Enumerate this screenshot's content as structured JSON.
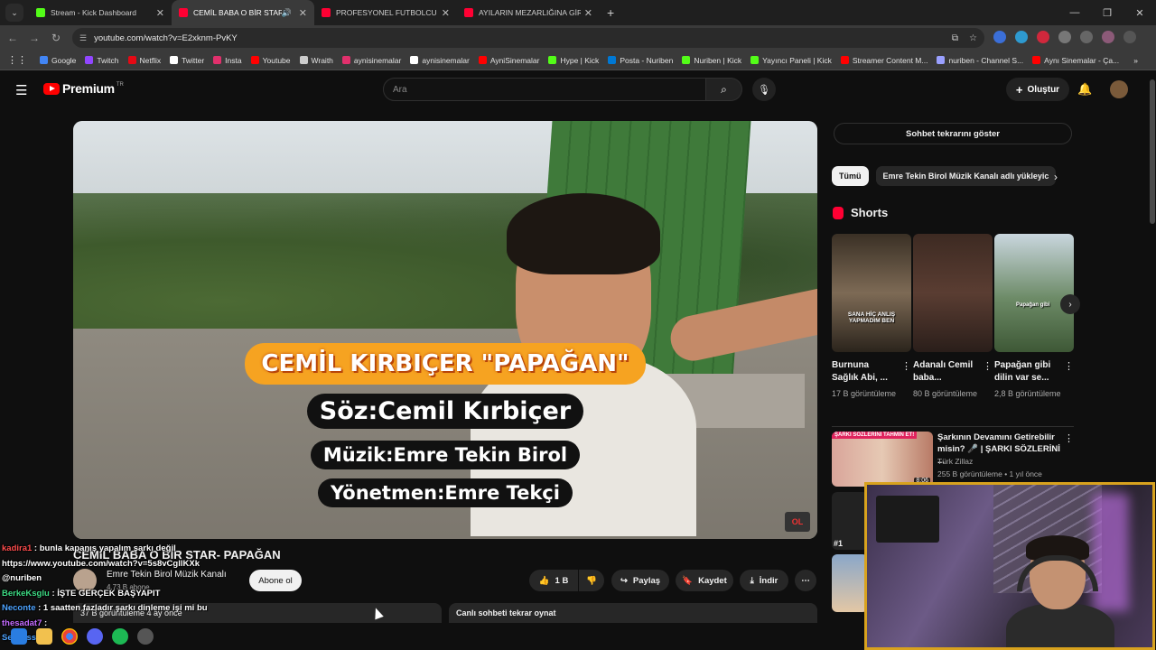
{
  "browser": {
    "tabs": [
      {
        "title": "Stream - Kick Dashboard",
        "favicon_color": "#53fc18",
        "active": false
      },
      {
        "title": "CEMİL BABA O BİR STAR- PA",
        "favicon_color": "#ff0033",
        "active": true
      },
      {
        "title": "PROFESYONEL FUTBOLCU SEN",
        "favicon_color": "#ff0033",
        "active": false
      },
      {
        "title": "AYILARIN MEZARLIĞINA GİRDİ",
        "favicon_color": "#ff0033",
        "active": false
      }
    ],
    "url": "youtube.com/watch?v=E2xknm-PvKY",
    "bookmarks": [
      {
        "label": "Google",
        "color": "#4285f4"
      },
      {
        "label": "Twitch",
        "color": "#9146ff"
      },
      {
        "label": "Netflix",
        "color": "#e50914"
      },
      {
        "label": "Twitter",
        "color": "#ffffff"
      },
      {
        "label": "Insta",
        "color": "#e1306c"
      },
      {
        "label": "Youtube",
        "color": "#ff0000"
      },
      {
        "label": "Wraith",
        "color": "#cccccc"
      },
      {
        "label": "aynisinemalar",
        "color": "#e1306c"
      },
      {
        "label": "aynisinemalar",
        "color": "#ffffff"
      },
      {
        "label": "AyniSinemalar",
        "color": "#ff0000"
      },
      {
        "label": "Hype | Kick",
        "color": "#53fc18"
      },
      {
        "label": "Posta - Nuriben",
        "color": "#0078d4"
      },
      {
        "label": "Nuriben | Kick",
        "color": "#53fc18"
      },
      {
        "label": "Yayıncı Paneli | Kick",
        "color": "#53fc18"
      },
      {
        "label": "Streamer Content M...",
        "color": "#ff0000"
      },
      {
        "label": "nuriben - Channel S...",
        "color": "#9aa0ff"
      },
      {
        "label": "Aynı Sinemalar - Ça...",
        "color": "#ff0000"
      }
    ]
  },
  "youtube": {
    "logo_text": "Premium",
    "logo_tr": "TR",
    "search_placeholder": "Ara",
    "create_label": "Oluştur"
  },
  "video": {
    "captions": {
      "title": "CEMİL KIRBIÇER \"PAPAĞAN\"",
      "lyrics": "Söz:Cemil Kırbiçer",
      "music": "Müzik:Emre Tekin Birol",
      "director": "Yönetmen:Emre Tekçi"
    },
    "watermark": "OL",
    "title": "CEMİL BABA O BİR STAR- PAPAĞAN",
    "channel": "Emre Tekin Birol Müzik Kanalı",
    "subs": "4,73 B abone",
    "subscribe_label": "Abone ol",
    "like_count": "1 B",
    "share_label": "Paylaş",
    "save_label": "Kaydet",
    "download_label": "İndir",
    "desc_meta": "37 B görüntüleme  4 ay önce",
    "chat_replay_label": "Canlı sohbeti tekrar oynat"
  },
  "chat": [
    {
      "user": "kadira1",
      "msg": ": bunla kapanış yapalım şarkı değil",
      "color": "#ff4d4d"
    },
    {
      "user": "",
      "msg": "https://www.youtube.com/watch?v=5s8vCgllKXk",
      "color": "#ffffff"
    },
    {
      "user": "@nuriben",
      "msg": "",
      "color": "#ffffff"
    },
    {
      "user": "BerkeKsglu",
      "msg": ": İŞTE GERÇEK BAŞYAPIT",
      "color": "#3ddc84"
    },
    {
      "user": "Neconte",
      "msg": ": 1 saatten fazladır şarkı dinleme işi mi bu",
      "color": "#4da3ff"
    },
    {
      "user": "thesadat7",
      "msg": ":",
      "color": "#c46bff"
    },
    {
      "user": "Seveliss",
      "msg": "",
      "color": "#4da3ff"
    }
  ],
  "sidebar": {
    "show_chat_label": "Sohbet tekrarını göster",
    "chips": [
      "Tümü",
      "Emre Tekin Birol Müzik Kanalı adlı yükleyic"
    ],
    "shorts_heading": "Shorts",
    "shorts": [
      {
        "title": "Burnuna Sağlık Abi, ...",
        "views": "17 B görüntüleme",
        "thumb_color": "#7d6a55",
        "overlay": "SANA HİÇ ANLIŞ YAPMADIM BEN"
      },
      {
        "title": "Adanalı Cemil baba...",
        "views": "80 B görüntüleme",
        "thumb_color": "#5a3d32",
        "overlay": ""
      },
      {
        "title": "Papağan gibi dilin var se...",
        "views": "2,8 B görüntüleme",
        "thumb_color": "#6c8a66",
        "overlay": "Papağan gibi"
      }
    ],
    "recommended": {
      "banner": "ŞARKI SÖZLERİNİ TAHMİN ET!",
      "duration": "8:06",
      "title": "Şarkının Devamını Getirebilir misin? 🎤 | ŞARKI SÖZLERİNİ ...",
      "channel": "Türk Zillaz",
      "meta": "255 B görüntüleme • 1 yıl önce"
    },
    "rec2_num": "#1"
  }
}
